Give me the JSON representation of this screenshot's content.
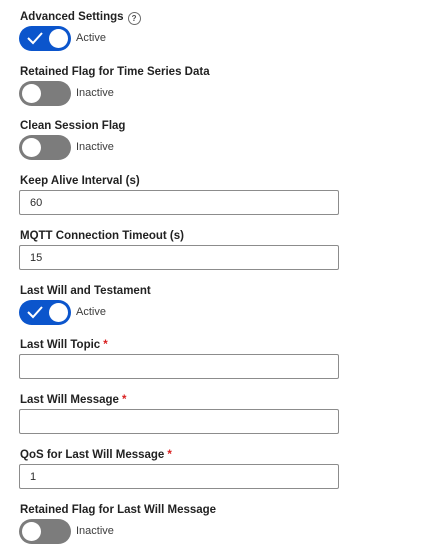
{
  "advanced_settings": {
    "label": "Advanced Settings",
    "help_glyph": "?",
    "toggle_state": "Active",
    "enabled": true
  },
  "retained_flag_ts": {
    "label": "Retained Flag for Time Series Data",
    "toggle_state": "Inactive",
    "enabled": false
  },
  "clean_session": {
    "label": "Clean Session Flag",
    "toggle_state": "Inactive",
    "enabled": false
  },
  "keep_alive": {
    "label": "Keep Alive Interval (s)",
    "value": "60"
  },
  "mqtt_timeout": {
    "label": "MQTT Connection Timeout (s)",
    "value": "15"
  },
  "last_will": {
    "label": "Last Will and Testament",
    "toggle_state": "Active",
    "enabled": true
  },
  "last_will_topic": {
    "label": "Last Will Topic",
    "required_mark": "*",
    "value": ""
  },
  "last_will_message": {
    "label": "Last Will Message",
    "required_mark": "*",
    "value": ""
  },
  "qos_last_will": {
    "label": "QoS for Last Will Message",
    "required_mark": "*",
    "value": "1"
  },
  "retained_flag_lw": {
    "label": "Retained Flag for Last Will Message",
    "toggle_state": "Inactive",
    "enabled": false
  },
  "colors": {
    "toggle_on": "#0b55cc",
    "toggle_off": "#7c7c7c",
    "required": "#d92020"
  }
}
